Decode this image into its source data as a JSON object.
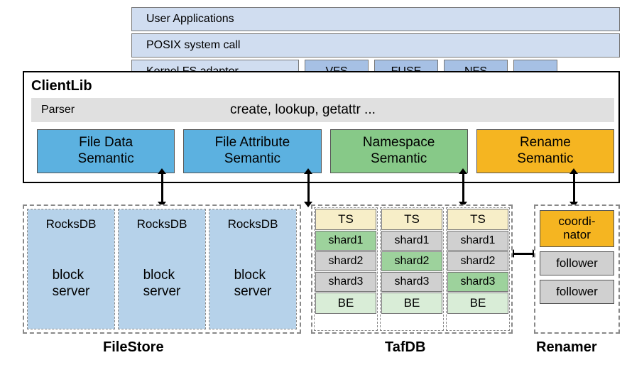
{
  "bars": {
    "user_applications": "User Applications",
    "posix": "POSIX system call",
    "kernel_fs": "Kernel FS adaptor",
    "adaptors": [
      "VFS",
      "FUSE",
      "NFS",
      "..."
    ]
  },
  "clientlib": {
    "title": "ClientLib",
    "parser": "Parser",
    "parser_calls": "create, lookup, getattr ...",
    "semantics": [
      {
        "label": "File Data\nSemantic",
        "color": "skyblue"
      },
      {
        "label": "File Attribute\nSemantic",
        "color": "skyblue"
      },
      {
        "label": "Namespace\nSemantic",
        "color": "green"
      },
      {
        "label": "Rename\nSemantic",
        "color": "yellow"
      }
    ]
  },
  "filestore": {
    "label": "FileStore",
    "cols": [
      {
        "db": "RocksDB",
        "server": "block\nserver"
      },
      {
        "db": "RocksDB",
        "server": "block\nserver"
      },
      {
        "db": "RocksDB",
        "server": "block\nserver"
      }
    ]
  },
  "tafdb": {
    "label": "TafDB",
    "cols": [
      {
        "ts": "TS",
        "shards": [
          {
            "t": "shard1",
            "c": "altgreen"
          },
          {
            "t": "shard2",
            "c": "graybox"
          },
          {
            "t": "shard3",
            "c": "graybox"
          }
        ],
        "be": "BE"
      },
      {
        "ts": "TS",
        "shards": [
          {
            "t": "shard1",
            "c": "graybox"
          },
          {
            "t": "shard2",
            "c": "altgreen"
          },
          {
            "t": "shard3",
            "c": "graybox"
          }
        ],
        "be": "BE"
      },
      {
        "ts": "TS",
        "shards": [
          {
            "t": "shard1",
            "c": "graybox"
          },
          {
            "t": "shard2",
            "c": "graybox"
          },
          {
            "t": "shard3",
            "c": "altgreen"
          }
        ],
        "be": "BE"
      }
    ]
  },
  "renamer": {
    "label": "Renamer",
    "coordinator": "coordi-\nnator",
    "followers": [
      "follower",
      "follower"
    ]
  }
}
